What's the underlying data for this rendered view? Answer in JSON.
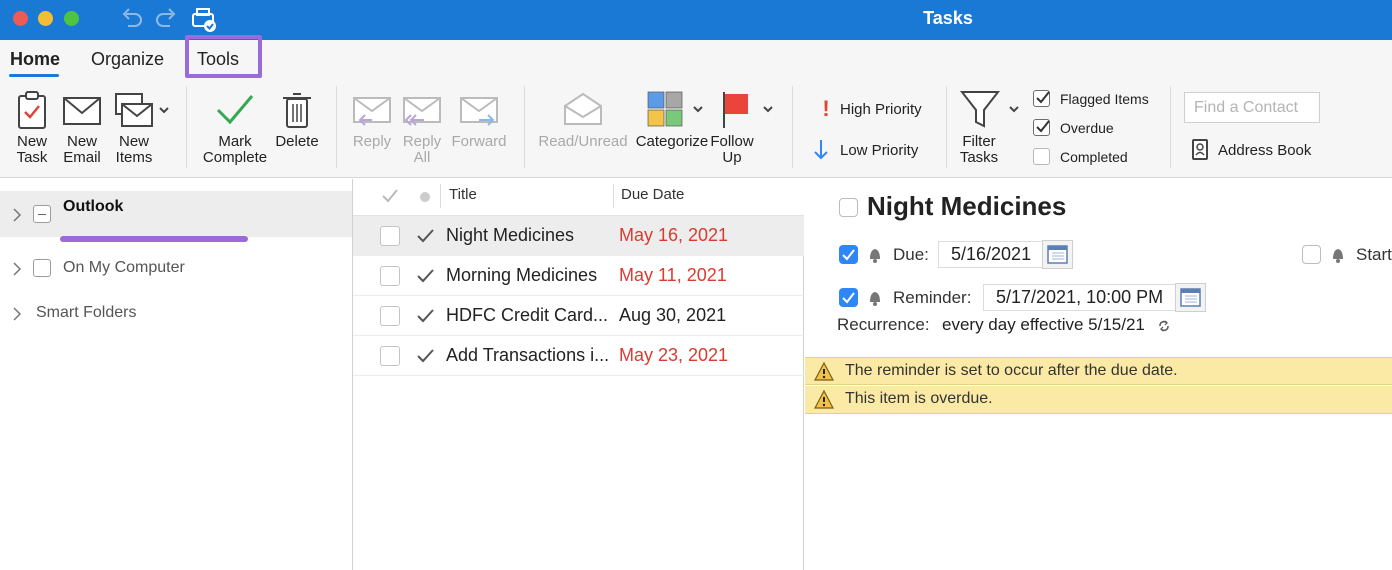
{
  "window": {
    "title": "Tasks"
  },
  "tabs": [
    {
      "label": "Home"
    },
    {
      "label": "Organize"
    },
    {
      "label": "Tools"
    }
  ],
  "ribbon": {
    "new_task": [
      "New",
      "Task"
    ],
    "new_email": [
      "New",
      "Email"
    ],
    "new_items": [
      "New",
      "Items"
    ],
    "mark_complete": [
      "Mark",
      "Complete"
    ],
    "delete": "Delete",
    "reply": "Reply",
    "reply_all": [
      "Reply",
      "All"
    ],
    "forward": "Forward",
    "read_unread": "Read/Unread",
    "categorize": "Categorize",
    "follow_up": [
      "Follow",
      "Up"
    ],
    "high_priority": "High Priority",
    "low_priority": "Low Priority",
    "filter_tasks": [
      "Filter",
      "Tasks"
    ],
    "filters": [
      {
        "label": "Flagged Items",
        "checked": true
      },
      {
        "label": "Overdue",
        "checked": true
      },
      {
        "label": "Completed",
        "checked": false
      }
    ],
    "find_contact_placeholder": "Find a Contact",
    "address_book": "Address Book"
  },
  "folders": [
    {
      "label": "Outlook",
      "selected": true
    },
    {
      "label": "On My Computer"
    },
    {
      "label": "Smart Folders"
    }
  ],
  "task_list": {
    "columns": {
      "title": "Title",
      "due_date": "Due Date"
    },
    "rows": [
      {
        "title": "Night Medicines",
        "due": "May 16, 2021",
        "overdue": true
      },
      {
        "title": "Morning Medicines",
        "due": "May 11, 2021",
        "overdue": true
      },
      {
        "title": "HDFC Credit Card...",
        "due": "Aug 30, 2021",
        "overdue": false
      },
      {
        "title": "Add Transactions i...",
        "due": "May 23, 2021",
        "overdue": true
      }
    ]
  },
  "reading_pane": {
    "title": "Night Medicines",
    "due_label": "Due:",
    "due_value": "5/16/2021",
    "start_label": "Start",
    "reminder_label": "Reminder:",
    "reminder_value": "5/17/2021, 10:00 PM",
    "recurrence_label": "Recurrence:",
    "recurrence_value": "every day effective 5/15/21",
    "warnings": [
      "The reminder is set to occur after the due date.",
      "This item is overdue."
    ]
  },
  "colors": {
    "titlebar": "#1b79d6",
    "overdue_text": "#d93b2f",
    "highlight_box": "#9a6cdb",
    "checkbox_blue": "#2f86f6",
    "warning_bg": "#fbe9a6"
  }
}
